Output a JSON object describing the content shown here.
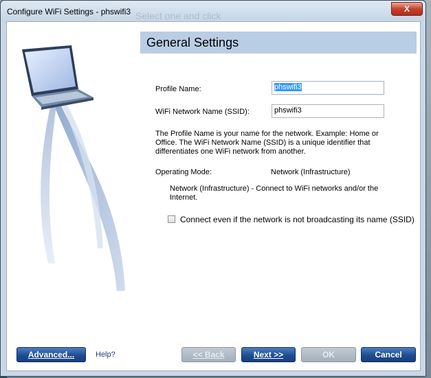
{
  "window": {
    "title": "Configure WiFi Settings - phswifi3",
    "background_text": "Select one and click",
    "close_label": "X"
  },
  "header": {
    "title": "General Settings"
  },
  "form": {
    "profile_name": {
      "label": "Profile Name:",
      "value": "phswifi3"
    },
    "ssid": {
      "label": "WiFi Network Name (SSID):",
      "value": "phswifi3"
    },
    "description_lines": [
      "The Profile Name is your name for the network. Example: Home or",
      "Office. The WiFi Network Name (SSID) is a unique identifier that",
      "differentiates one WiFi network from another."
    ],
    "operating_mode": {
      "label": "Operating Mode:",
      "value": "Network (Infrastructure)"
    },
    "mode_description_lines": [
      "Network (Infrastructure) - Connect to WiFi networks and/or the",
      "Internet."
    ],
    "broadcast_checkbox": {
      "label": "Connect even if the network is not broadcasting its name (SSID)",
      "checked": false
    }
  },
  "footer": {
    "advanced_label": "Advanced...",
    "help_label": "Help?",
    "back_label": "<< Back",
    "next_label": "Next >>",
    "ok_label": "OK",
    "cancel_label": "Cancel"
  },
  "colors": {
    "header_band": "#b9cde4",
    "button_primary": "#1e4d92",
    "button_disabled": "#a4afba",
    "selection": "#3399ff"
  },
  "icons": {
    "illustration": "laptop-with-signal-beam"
  }
}
